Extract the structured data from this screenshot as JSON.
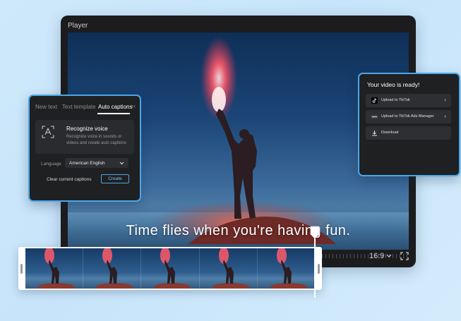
{
  "player": {
    "title": "Player",
    "caption": "Time flies when you're having fun.",
    "aspect_ratio": "16:9",
    "icons": {
      "ratio_dropdown": "chevron-down-icon",
      "fullscreen": "fullscreen-icon"
    }
  },
  "text_panel": {
    "tabs": [
      {
        "label": "New text",
        "active": false
      },
      {
        "label": "Text template",
        "active": false
      },
      {
        "label": "Auto captions",
        "active": true
      }
    ],
    "collapse_icon": "double-chevron-left-icon",
    "recognize": {
      "icon": "speech-recognition-icon",
      "title": "Recognize voice",
      "description": "Recognize voice in sounds or videos and create auto captions"
    },
    "language_label": "Language",
    "language_value": "American English",
    "clear_label": "Clear current captions",
    "create_label": "Create"
  },
  "ready_panel": {
    "title": "Your video is ready!",
    "items": [
      {
        "icon": "tiktok-icon",
        "label": "Upload to TikTok",
        "chevron": true
      },
      {
        "icon": "tiktok-ads-icon",
        "label": "Upload to TikTok Ads Manager",
        "chevron": true
      },
      {
        "icon": "download-icon",
        "label": "Download",
        "chevron": false
      }
    ]
  },
  "timeline": {
    "frame_count": 5
  },
  "colors": {
    "accent": "#4aa7e8",
    "panel_bg": "#1f2022",
    "player_bg": "#1c1c1e"
  }
}
